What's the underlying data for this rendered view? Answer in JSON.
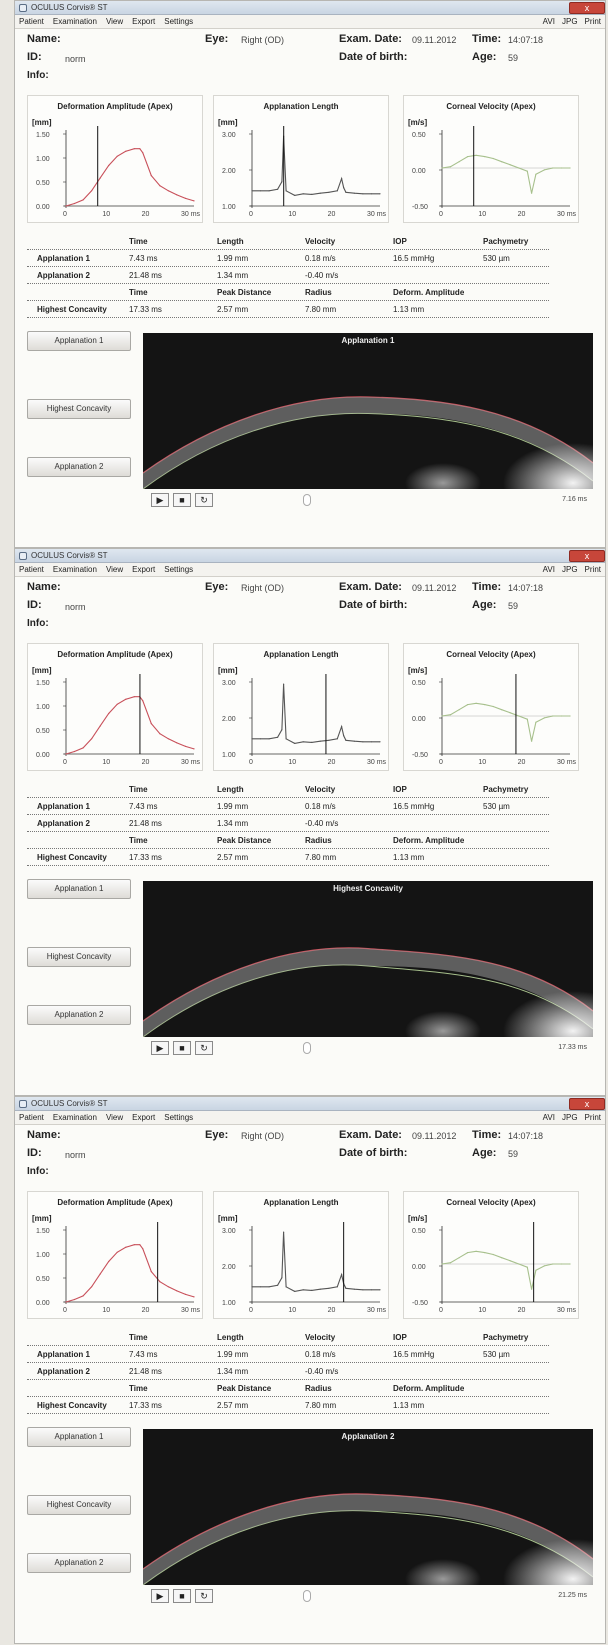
{
  "window": {
    "title": "OCULUS Corvis® ST",
    "close_label": "x"
  },
  "menu": {
    "items": [
      "Patient",
      "Examination",
      "View",
      "Export",
      "Settings"
    ],
    "actions": [
      "AVI",
      "JPG",
      "Print"
    ]
  },
  "patient": {
    "name_label": "Name:",
    "id_label": "ID:",
    "id_value": "norm",
    "info_label": "Info:",
    "eye_label": "Eye:",
    "eye_value": "Right (OD)",
    "exam_date_label": "Exam. Date:",
    "exam_date_value": "09.11.2012",
    "dob_label": "Date of birth:",
    "time_label": "Time:",
    "time_value": "14:07:18",
    "age_label": "Age:",
    "age_value": "59"
  },
  "charts": {
    "deformation": {
      "title": "Deformation Amplitude (Apex)",
      "unit": "[mm]",
      "yticks": [
        "1.50",
        "1.00",
        "0.50",
        "0.00"
      ],
      "xticks": [
        "0",
        "10",
        "20",
        "30 ms"
      ]
    },
    "applanation": {
      "title": "Applanation Length",
      "unit": "[mm]",
      "yticks": [
        "3.00",
        "2.00",
        "1.00"
      ],
      "xticks": [
        "0",
        "10",
        "20",
        "30 ms"
      ]
    },
    "velocity": {
      "title": "Corneal Velocity (Apex)",
      "unit": "[m/s]",
      "yticks": [
        "0.50",
        "0.00",
        "-0.50"
      ],
      "xticks": [
        "0",
        "10",
        "20",
        "30 ms"
      ]
    }
  },
  "chart_data": [
    {
      "type": "line",
      "title": "Deformation Amplitude (Apex)",
      "ylabel": "[mm]",
      "xlim": [
        0,
        30
      ],
      "ylim": [
        0,
        1.5
      ],
      "x": [
        0,
        2,
        4,
        6,
        8,
        10,
        12,
        14,
        16,
        17.3,
        18,
        20,
        22,
        24,
        26,
        28,
        30
      ],
      "y": [
        0.0,
        0.05,
        0.12,
        0.3,
        0.55,
        0.8,
        0.98,
        1.08,
        1.13,
        1.13,
        1.05,
        0.6,
        0.4,
        0.3,
        0.22,
        0.15,
        0.1
      ]
    },
    {
      "type": "line",
      "title": "Applanation Length",
      "ylabel": "[mm]",
      "xlim": [
        0,
        30
      ],
      "ylim": [
        0.5,
        3.0
      ],
      "x": [
        0,
        2,
        4,
        6,
        7,
        7.4,
        8,
        10,
        12,
        14,
        16,
        18,
        20,
        21,
        21.5,
        22,
        24,
        26,
        28,
        30
      ],
      "y": [
        1.0,
        1.0,
        1.0,
        1.05,
        1.3,
        2.8,
        1.0,
        0.85,
        0.9,
        0.88,
        0.92,
        0.95,
        1.0,
        1.4,
        1.1,
        0.95,
        0.92,
        0.9,
        0.9,
        0.9
      ]
    },
    {
      "type": "line",
      "title": "Corneal Velocity (Apex)",
      "ylabel": "[m/s]",
      "xlim": [
        0,
        30
      ],
      "ylim": [
        -0.6,
        0.6
      ],
      "x": [
        0,
        2,
        4,
        6,
        8,
        10,
        12,
        14,
        16,
        18,
        20,
        21,
        22,
        24,
        26,
        28,
        30
      ],
      "y": [
        0.0,
        0.02,
        0.1,
        0.18,
        0.2,
        0.18,
        0.15,
        0.1,
        0.05,
        0.0,
        -0.05,
        -0.4,
        -0.1,
        -0.03,
        0.0,
        0.0,
        0.0
      ]
    }
  ],
  "table": {
    "header1": [
      "Time",
      "Length",
      "Velocity",
      "IOP",
      "Pachymetry"
    ],
    "rows": [
      {
        "label": "Applanation 1",
        "cells": [
          "7.43 ms",
          "1.99 mm",
          "0.18 m/s",
          "16.5 mmHg",
          "530 µm"
        ]
      },
      {
        "label": "Applanation 2",
        "cells": [
          "21.48 ms",
          "1.34 mm",
          "-0.40 m/s",
          "",
          ""
        ]
      }
    ],
    "header2": [
      "Time",
      "Peak Distance",
      "Radius",
      "Deform. Amplitude"
    ],
    "concavity": {
      "label": "Highest Concavity",
      "cells": [
        "17.33 ms",
        "2.57 mm",
        "7.80 mm",
        "1.13 mm"
      ]
    }
  },
  "side_buttons": [
    "Applanation 1",
    "Highest Concavity",
    "Applanation 2"
  ],
  "frames": [
    {
      "video_title": "Applanation 1",
      "time_readout": "7.16 ms"
    },
    {
      "video_title": "Highest Concavity",
      "time_readout": "17.33 ms"
    },
    {
      "video_title": "Applanation 2",
      "time_readout": "21.25 ms"
    }
  ],
  "controls": {
    "play_label": "▶",
    "stop_label": "■",
    "repeat_label": "↻"
  },
  "colors": {
    "curve_red": "#c8505a",
    "curve_green": "#a7c08c",
    "axis": "#333333",
    "cursor": "#111111"
  }
}
